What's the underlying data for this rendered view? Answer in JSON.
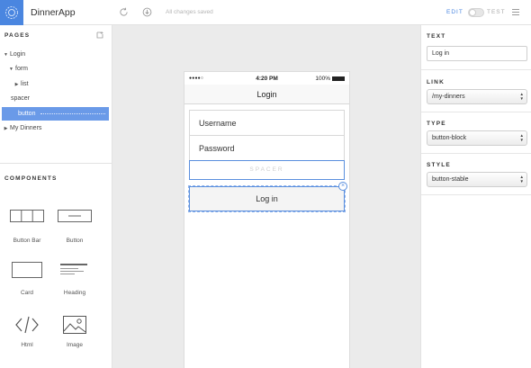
{
  "app": {
    "title": "DinnerApp",
    "saved_status": "All changes saved"
  },
  "modes": {
    "edit": "EDIT",
    "test": "TEST"
  },
  "pages": {
    "title": "PAGES",
    "items": [
      {
        "label": "Login",
        "arrow": "▼"
      },
      {
        "label": "form",
        "arrow": "▼"
      },
      {
        "label": "list",
        "arrow": "▶"
      },
      {
        "label": "spacer",
        "arrow": ""
      },
      {
        "label": "button",
        "arrow": ""
      },
      {
        "label": "My Dinners",
        "arrow": "▶"
      }
    ]
  },
  "components": {
    "title": "COMPONENTS",
    "items": [
      {
        "label": "Button Bar",
        "icon": "button-bar-icon"
      },
      {
        "label": "Button",
        "icon": "button-icon"
      },
      {
        "label": "Card",
        "icon": "card-icon"
      },
      {
        "label": "Heading",
        "icon": "heading-icon"
      },
      {
        "label": "Html",
        "icon": "html-icon"
      },
      {
        "label": "Image",
        "icon": "image-icon"
      }
    ]
  },
  "phone": {
    "status": {
      "signal": "●●●●○",
      "time": "4:20 PM",
      "battery": "100%"
    },
    "nav_title": "Login",
    "fields": [
      "Username",
      "Password"
    ],
    "spacer_label": "SPACER",
    "button_label": "Log in",
    "remove_glyph": "×"
  },
  "properties": {
    "text": {
      "label": "TEXT",
      "value": "Log in"
    },
    "link": {
      "label": "LINK",
      "value": "/my-dinners"
    },
    "type": {
      "label": "TYPE",
      "value": "button-block"
    },
    "style": {
      "label": "STYLE",
      "value": "button-stable"
    }
  },
  "colors": {
    "accent": "#4a86e0",
    "selected": "#6a9ae8",
    "canvas": "#ebebeb"
  }
}
